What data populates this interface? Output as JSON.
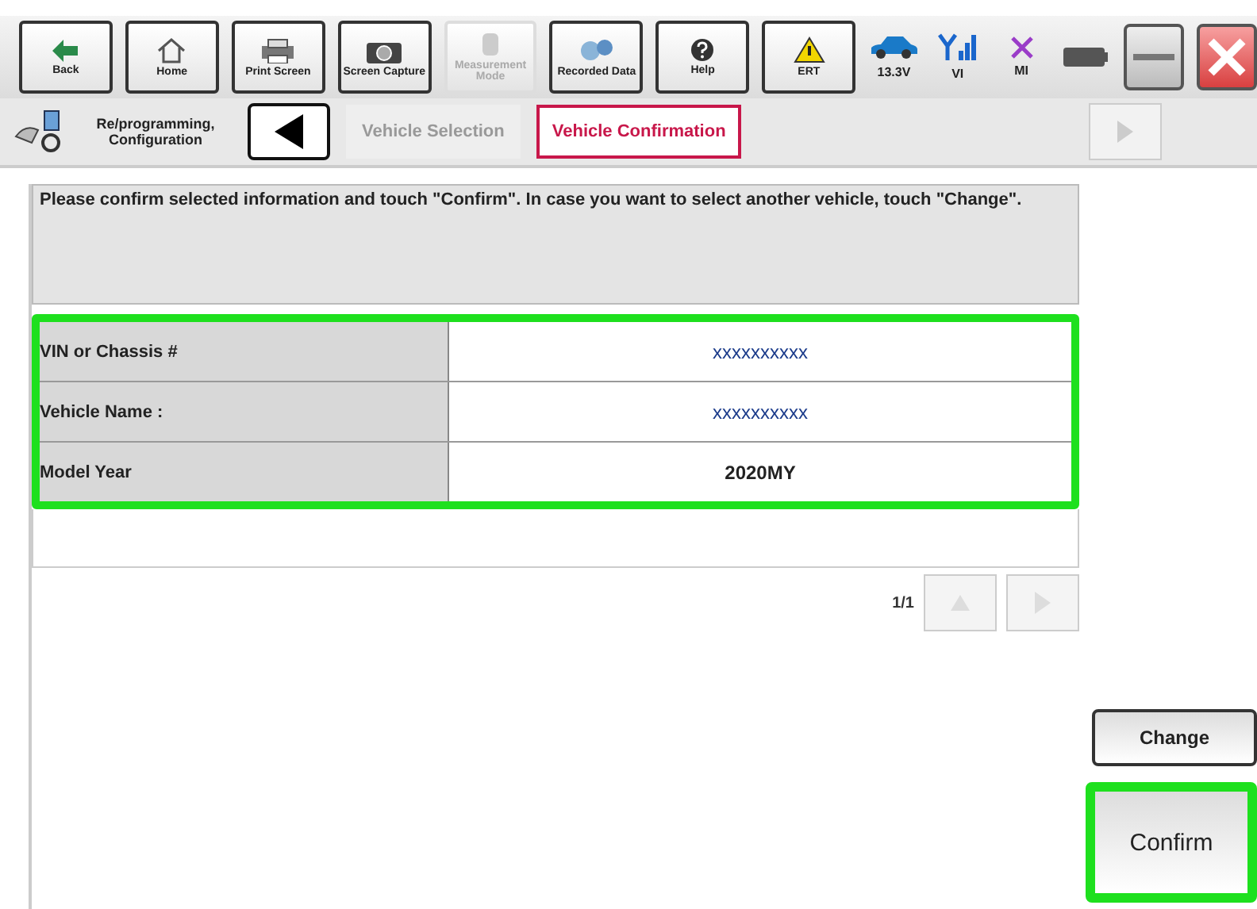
{
  "toolbar": {
    "buttons": [
      {
        "kind": "back",
        "label": "Back",
        "disabled": false
      },
      {
        "kind": "home",
        "label": "Home",
        "disabled": false
      },
      {
        "kind": "print",
        "label": "Print Screen",
        "disabled": false
      },
      {
        "kind": "camera",
        "label": "Screen Capture",
        "disabled": false
      },
      {
        "kind": "measure",
        "label": "Measurement Mode",
        "disabled": true
      },
      {
        "kind": "data",
        "label": "Recorded Data",
        "disabled": false
      },
      {
        "kind": "help",
        "label": "Help",
        "disabled": false
      },
      {
        "kind": "ert",
        "label": "ERT",
        "disabled": false
      }
    ],
    "status": [
      {
        "kind": "car",
        "label": "13.3V"
      },
      {
        "kind": "signal",
        "label": "VI"
      },
      {
        "kind": "cross",
        "label": "MI"
      },
      {
        "kind": "battery"
      }
    ]
  },
  "breadcrumb": {
    "title": "Re/programming, Configuration",
    "steps": [
      {
        "label": "Vehicle Selection",
        "selected": false
      },
      {
        "label": "Vehicle Confirmation",
        "selected": true
      }
    ]
  },
  "message": "Please confirm selected information and touch \"Confirm\". In case you want to select another vehicle, touch \"Change\".",
  "table": {
    "highlighted": true,
    "rows": [
      {
        "label": "VIN or Chassis #",
        "value": "xxxxxxxxxx",
        "blue": true
      },
      {
        "label": "Vehicle Name :",
        "value": "xxxxxxxxxx",
        "blue": true
      },
      {
        "label": "Model Year",
        "value": "2020MY",
        "blue": false
      }
    ]
  },
  "pagination": "1/1",
  "buttons": [
    {
      "label": "Change",
      "highlighted": false
    },
    {
      "label": "Confirm",
      "highlighted": true
    }
  ]
}
